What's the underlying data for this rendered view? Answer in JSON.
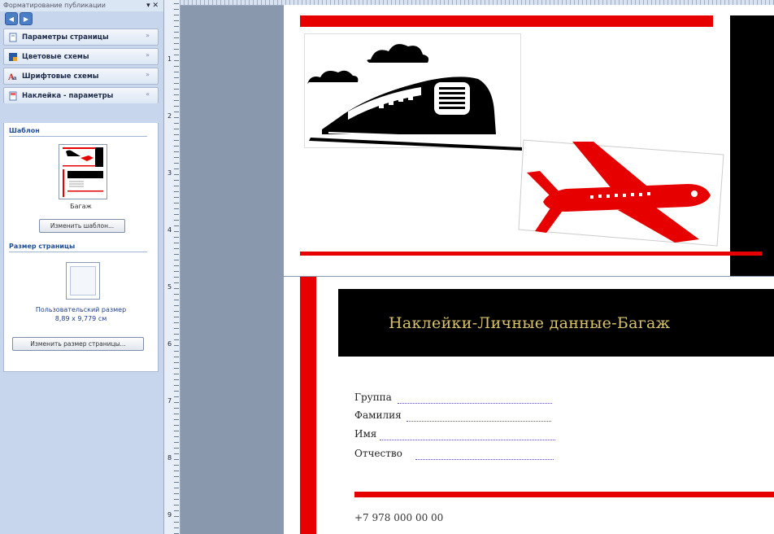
{
  "pane": {
    "title": "Форматирование публикации",
    "sections": [
      {
        "label": "Параметры страницы"
      },
      {
        "label": "Цветовые схемы"
      },
      {
        "label": "Шрифтовые схемы"
      },
      {
        "label": "Наклейка - параметры"
      }
    ],
    "template_group": "Шаблон",
    "template_name": "Багаж",
    "change_template_button": "Изменить шаблон...",
    "page_size_group": "Размер страницы",
    "page_size_name": "Пользовательский размер",
    "page_size_value": "8,89 x 9,779 см",
    "change_size_button": "Изменить размер страницы..."
  },
  "ruler": {
    "numbers": [
      "1",
      "2",
      "3",
      "4",
      "5",
      "6",
      "7",
      "8",
      "9"
    ]
  },
  "label": {
    "title": "Наклейки-Личные данные-Багаж",
    "fields": [
      "Группа",
      "Фамилия",
      "Имя",
      "Отчество"
    ],
    "phone": "+7 978 000 00 00"
  },
  "colors": {
    "accent_red": "#e60000",
    "band": "#000000",
    "title_gold": "#d8c36a"
  },
  "icons": [
    "train-clipart",
    "airplane-clipart",
    "page-setup-icon",
    "color-scheme-icon",
    "font-scheme-icon",
    "label-options-icon"
  ]
}
